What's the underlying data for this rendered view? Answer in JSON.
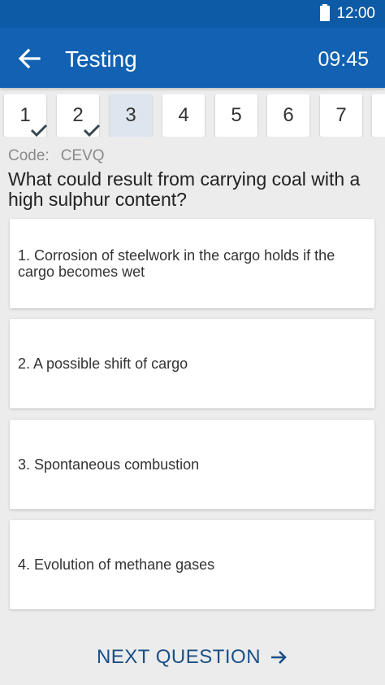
{
  "status_bar": {
    "time": "12:00",
    "battery_icon": "battery-icon"
  },
  "header": {
    "back_icon": "arrow-left-icon",
    "title": "Testing",
    "timer": "09:45",
    "background_color": "#1261b2"
  },
  "questions_nav": {
    "items": [
      {
        "number": "1",
        "answered": true
      },
      {
        "number": "2",
        "answered": true
      },
      {
        "number": "3",
        "answered": false,
        "current": true
      },
      {
        "number": "4",
        "answered": false
      },
      {
        "number": "5",
        "answered": false
      },
      {
        "number": "6",
        "answered": false
      },
      {
        "number": "7",
        "answered": false
      }
    ]
  },
  "question": {
    "code_label": "Code:",
    "code": "CEVQ",
    "text": "What could result from carrying coal with a high sulphur content?"
  },
  "answers": [
    {
      "text": "1. Corrosion of steelwork in the cargo holds if the cargo becomes wet"
    },
    {
      "text": "2. A possible shift of cargo"
    },
    {
      "text": "3. Spontaneous combustion"
    },
    {
      "text": "4. Evolution of methane gases"
    }
  ],
  "footer": {
    "next_label": "NEXT QUESTION",
    "next_icon": "arrow-right-icon",
    "accent_color": "#1a4f86"
  }
}
